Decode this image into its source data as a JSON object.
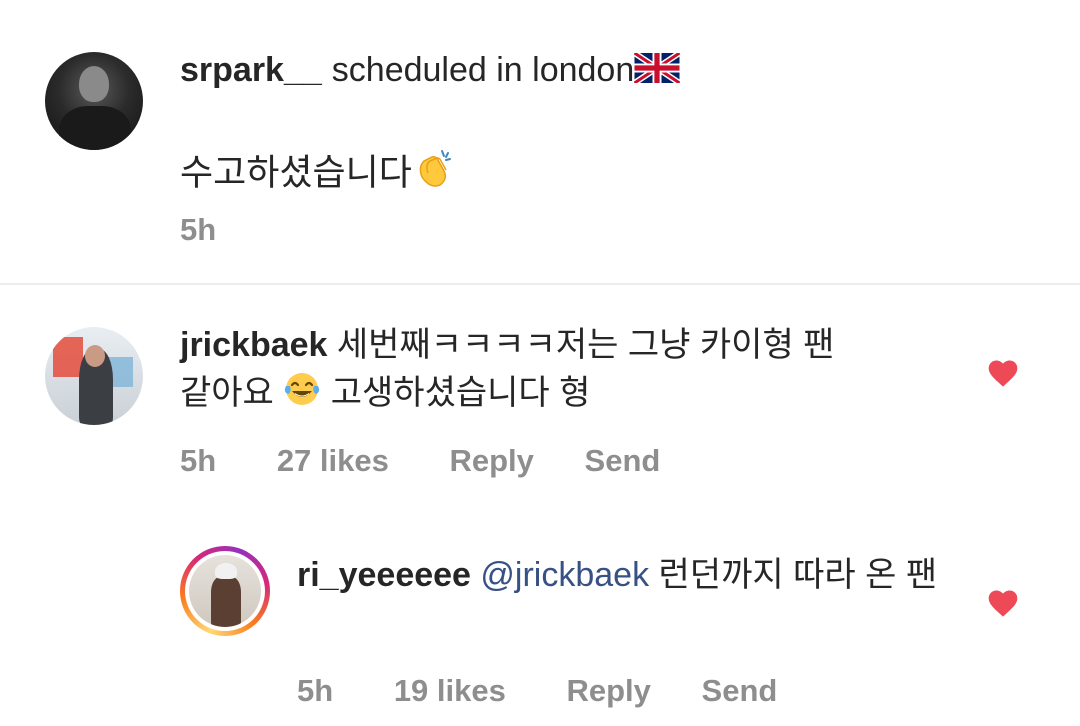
{
  "caption": {
    "username": "srpark__",
    "location": "scheduled in london",
    "location_emoji": "uk-flag",
    "text": "수고하셨습니다",
    "text_emoji": "clapping-hands",
    "time": "5h"
  },
  "comment": {
    "username": "jrickbaek",
    "text_part1": "세번째ㅋㅋㅋㅋ저는 그냥 카이형 팬",
    "text_part2": "같아요",
    "emoji": "tears-of-joy",
    "text_part3": "고생하셨습니다 형",
    "time": "5h",
    "likes": "27 likes",
    "reply_label": "Reply",
    "send_label": "Send",
    "liked": true
  },
  "reply": {
    "username": "ri_yeeeeee",
    "mention": "@jrickbaek",
    "text": "런던까지 따라 온 팬",
    "time": "5h",
    "likes": "19 likes",
    "reply_label": "Reply",
    "send_label": "Send",
    "liked": true
  },
  "colors": {
    "heart": "#ed4956",
    "meta_gray": "#8e8e8e",
    "mention_blue": "#385185",
    "text": "#262626"
  }
}
